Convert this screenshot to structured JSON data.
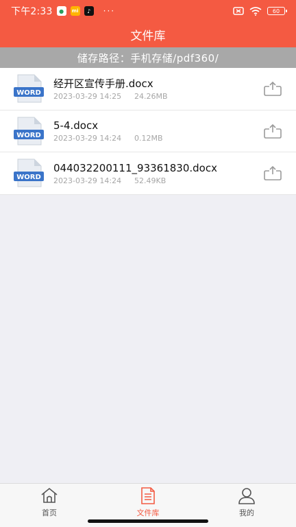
{
  "status_bar": {
    "time": "下午2:33",
    "app_icon_b_text": "mi",
    "dots": "···",
    "battery": "60"
  },
  "header": {
    "title": "文件库"
  },
  "path_bar": {
    "text": "储存路径：手机存储/pdf360/"
  },
  "file_badge": "WORD",
  "files": [
    {
      "name": "经开区宣传手册.docx",
      "date": "2023-03-29 14:25",
      "size": "24.26MB"
    },
    {
      "name": "5-4.docx",
      "date": "2023-03-29 14:24",
      "size": "0.12MB"
    },
    {
      "name": "044032200111_93361830.docx",
      "date": "2023-03-29 14:24",
      "size": "52.49KB"
    }
  ],
  "bottom_nav": [
    {
      "label": "首页",
      "icon": "home-icon"
    },
    {
      "label": "文件库",
      "icon": "file-icon",
      "active": true
    },
    {
      "label": "我的",
      "icon": "profile-icon"
    }
  ],
  "colors": {
    "accent": "#f45a42",
    "path_bar": "#a8a8a8",
    "word_blue": "#3a74c9"
  }
}
